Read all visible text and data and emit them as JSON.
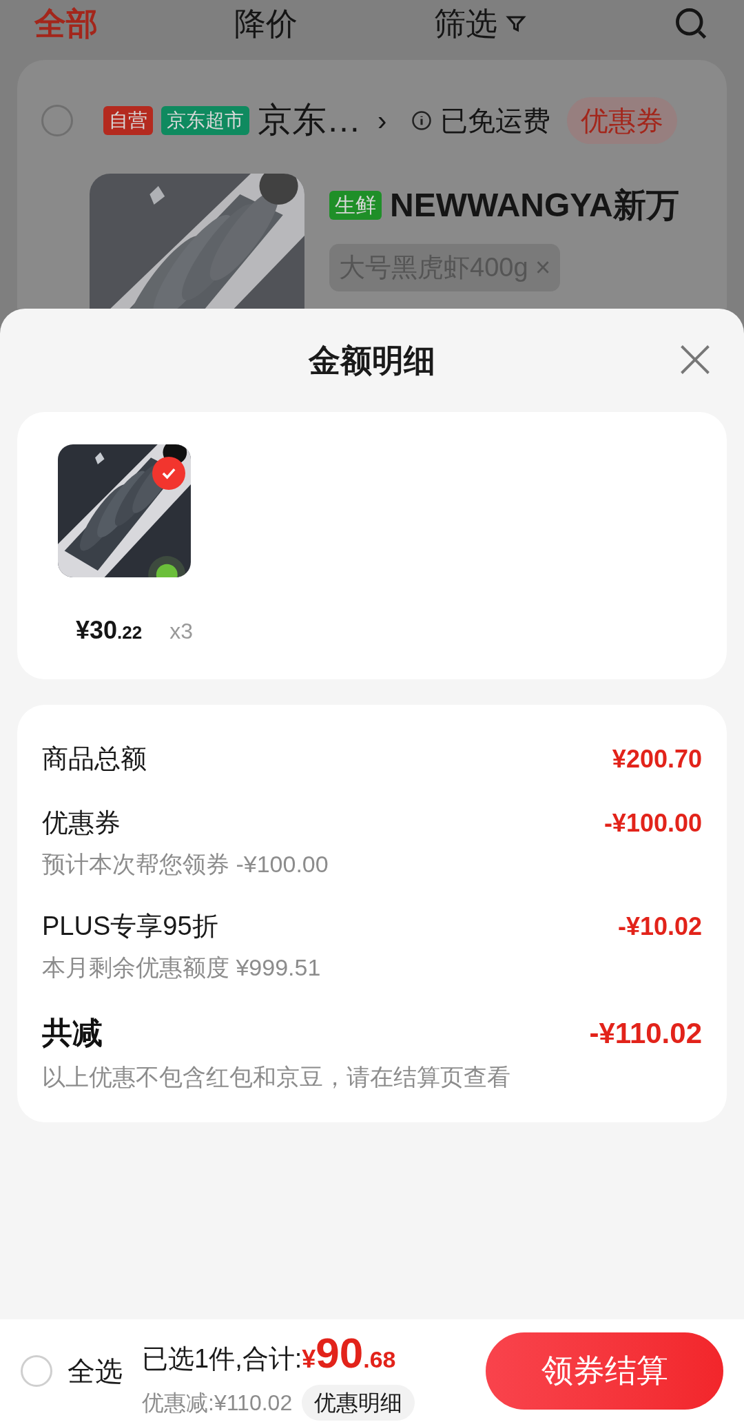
{
  "top_tabs": [
    {
      "label": "全部",
      "selected": true
    },
    {
      "label": "降价",
      "selected": false
    },
    {
      "label": "筛选",
      "selected": false,
      "kind": "filter"
    }
  ],
  "store": {
    "checked": false,
    "badges": [
      {
        "label": "自营",
        "color": "#b42a1f"
      },
      {
        "label": "京东超市",
        "color": "#0f8a5f"
      }
    ],
    "name": "京东…",
    "arrow": "›",
    "shipping": "已免运费",
    "coupon": "优惠券"
  },
  "product": {
    "tag": "生鲜",
    "title": "NEWWANGYA新万",
    "spec": "大号黑虎虾400g ×"
  },
  "sheet": {
    "title": "金额明细",
    "item": {
      "checked": true,
      "price_main": "¥30",
      "price_decimal": ".22",
      "quantity": "x3"
    },
    "lines": [
      {
        "label": "商品总额",
        "amount": "¥200.70",
        "kind": "normal"
      },
      {
        "label": "优惠券",
        "amount": "-¥100.00",
        "note": "预计本次帮您领券 -¥100.00",
        "kind": "normal"
      },
      {
        "label": "PLUS专享95折",
        "amount": "-¥10.02",
        "note": "本月剩余优惠额度 ¥999.51",
        "kind": "normal"
      },
      {
        "label": "共减",
        "amount": "-¥110.02",
        "note": "以上优惠不包含红包和京豆，请在结算页查看",
        "kind": "total"
      }
    ]
  },
  "bottom_bar": {
    "select_all": {
      "label": "全选",
      "checked": false
    },
    "summary": "已选1件,合计:",
    "total_symbol": "¥",
    "total_main": "90",
    "total_decimal": ".68",
    "discount": "优惠减:¥110.02",
    "detail_button": "优惠明细",
    "checkout_button": "领券结算"
  }
}
